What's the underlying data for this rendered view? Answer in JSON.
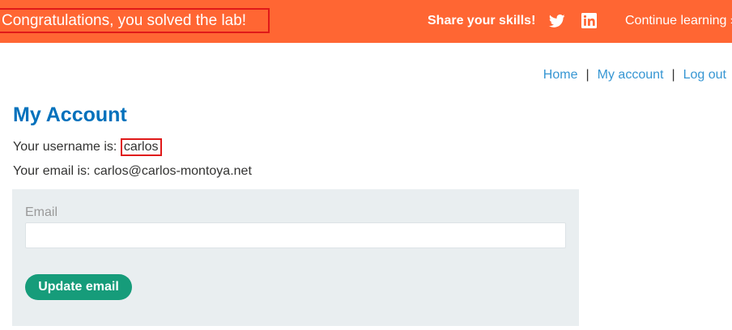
{
  "banner": {
    "title": "Congratulations, you solved the lab!",
    "share_label": "Share your skills!",
    "twitter_icon": "twitter-icon",
    "linkedin_icon": "linkedin-icon",
    "continue_label": "Continue learning »"
  },
  "nav": {
    "home": "Home",
    "sep1": "|",
    "my_account": "My account",
    "sep2": "|",
    "logout": "Log out"
  },
  "page": {
    "heading": "My Account",
    "username_prefix": "Your username is: ",
    "username": "carlos",
    "email_line": "Your email is: carlos@carlos-montoya.net"
  },
  "form": {
    "email_label": "Email",
    "email_value": "",
    "submit_label": "Update email"
  },
  "colors": {
    "banner": "#ff6633",
    "link": "#3696d3",
    "heading": "#0071bc",
    "button": "#169c7a",
    "panel": "#e9eef0",
    "highlight_border": "#e01919"
  }
}
